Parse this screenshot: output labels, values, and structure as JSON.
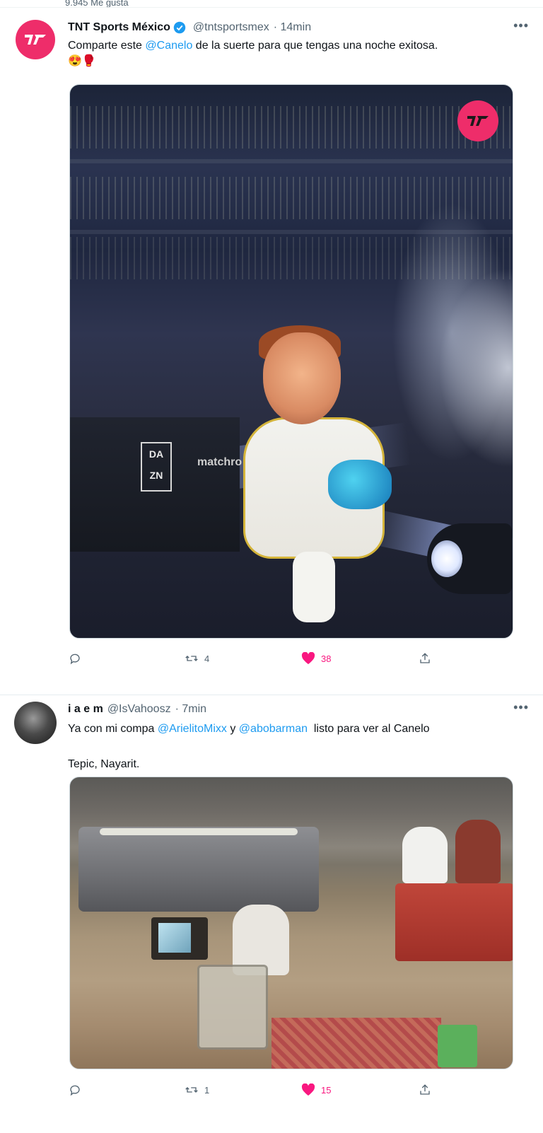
{
  "top": {
    "likes_text": "9.945 Me gusta"
  },
  "colors": {
    "brand": "#ee2d6a",
    "like": "#f91880",
    "link": "#1d9bf0",
    "verified": "#1d9bf0",
    "muted": "#536471"
  },
  "tweets": [
    {
      "display_name": "TNT Sports México",
      "verified": true,
      "handle": "@tntsportsmex",
      "time": "· 14min",
      "text_before": "Comparte este ",
      "mention": "@Canelo",
      "text_after": " de la suerte para que tengas una noche exitosa.",
      "emojis": "😍🥊",
      "media_text": {
        "dazn": "DA ZN",
        "sign": "matchro"
      },
      "actions": {
        "replies": "",
        "retweets": "4",
        "likes": "38"
      },
      "icons": [
        "reply-icon",
        "retweet-icon",
        "heart-icon",
        "share-icon"
      ]
    },
    {
      "display_name": "i a e m",
      "handle": "@IsVahoosz",
      "time": "· 7min",
      "text_before": "Ya con mi compa ",
      "mention1": "@ArielitoMixx",
      "text_mid": " y ",
      "mention2": "@abobarman",
      "text_after": "  listo para ver al Canelo",
      "location": "Tepic, Nayarit.",
      "actions": {
        "replies": "",
        "retweets": "1",
        "likes": "15"
      },
      "icons": [
        "reply-icon",
        "retweet-icon",
        "heart-icon",
        "share-icon"
      ]
    }
  ]
}
